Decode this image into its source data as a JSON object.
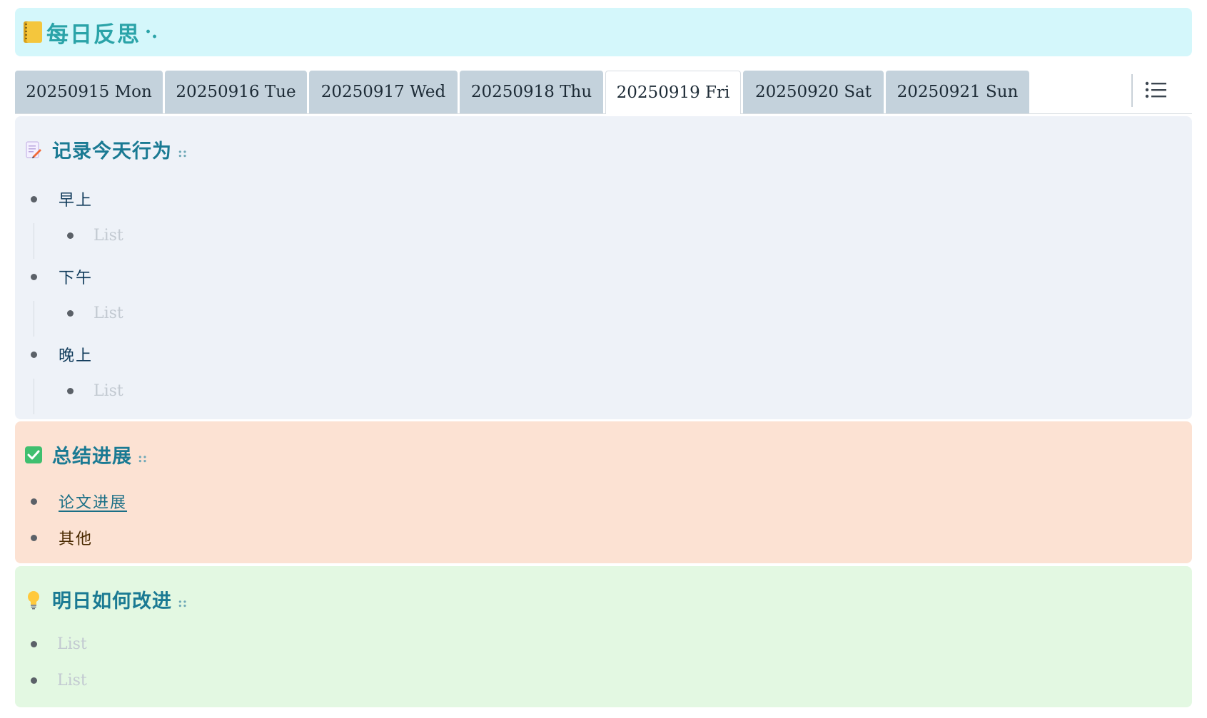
{
  "header": {
    "title": "每日反思",
    "suffix": "·.",
    "icon": "notebook-icon"
  },
  "tabs": [
    {
      "label": "20250915 Mon",
      "active": false
    },
    {
      "label": "20250916 Tue",
      "active": false
    },
    {
      "label": "20250917 Wed",
      "active": false
    },
    {
      "label": "20250918 Thu",
      "active": false
    },
    {
      "label": "20250919 Fri",
      "active": true
    },
    {
      "label": "20250920 Sat",
      "active": false
    },
    {
      "label": "20250921 Sun",
      "active": false
    }
  ],
  "toolbar": {
    "list_icon": "list-icon"
  },
  "sections": {
    "record": {
      "title": "记录今天行为",
      "icon": "memo-icon",
      "color": "#eef2f8",
      "groups": [
        {
          "label": "早上",
          "child": "List"
        },
        {
          "label": "下午",
          "child": "List"
        },
        {
          "label": "晚上",
          "child": "List"
        }
      ]
    },
    "summary": {
      "title": "总结进展",
      "icon": "check-mark-icon",
      "color": "#fce2d3",
      "items": [
        {
          "label": "论文进展",
          "link": true
        },
        {
          "label": "其他",
          "link": false
        }
      ]
    },
    "improve": {
      "title": "明日如何改进",
      "icon": "lightbulb-icon",
      "color": "#e3f8e2",
      "items": [
        "List",
        "List"
      ]
    }
  },
  "colors": {
    "header_bg": "#d4f7fb",
    "heading_text": "#1a7a93",
    "tab_bg": "#c4d2dc"
  }
}
